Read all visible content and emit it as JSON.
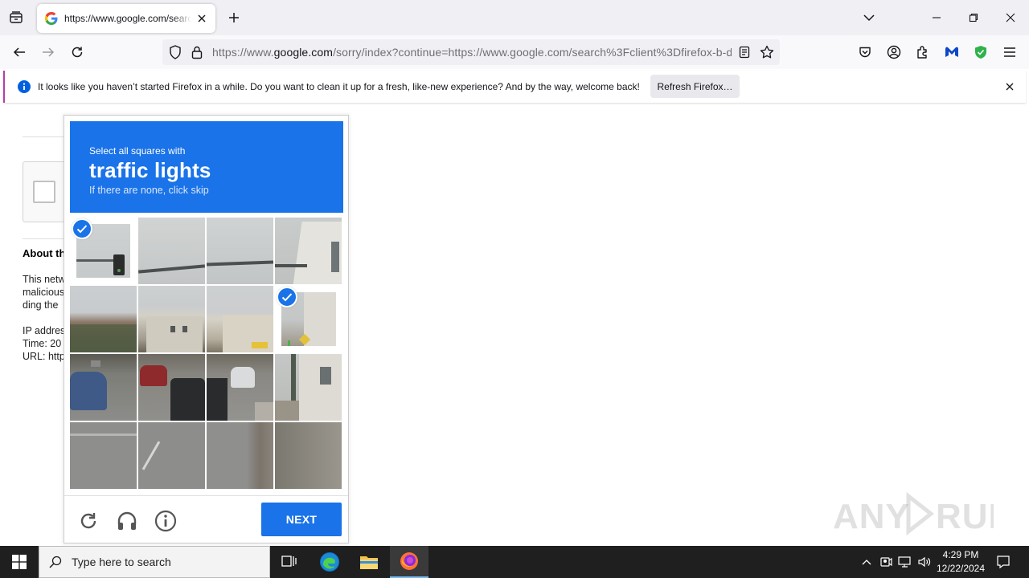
{
  "browser": {
    "tab_title": "https://www.google.com/search",
    "url_prefix": "https://www.",
    "url_host": "google.com",
    "url_rest": "/sorry/index?continue=https://www.google.com/search%3Fclient%3Dfirefox-b-d%"
  },
  "notification": {
    "message": "It looks like you haven’t started Firefox in a while. Do you want to clean it up for a fresh, like-new experience? And by the way, welcome back!",
    "button_label": "Refresh Firefox…"
  },
  "page": {
    "about_heading": "About th",
    "body_line1": "This netw",
    "body_line2": "malicious",
    "body_line3": "ding the",
    "ip_line": "IP addres",
    "time_line": "Time: 20",
    "url_line": "URL: http"
  },
  "captcha": {
    "instruction_small": "Select all squares with",
    "target": "traffic lights",
    "instruction_skip": "If there are none, click skip",
    "next_label": "NEXT",
    "selected_tiles": [
      0,
      7
    ]
  },
  "taskbar": {
    "search_placeholder": "Type here to search",
    "time": "4:29 PM",
    "date": "12/22/2024"
  },
  "watermark": "ANY RUN",
  "colors": {
    "accent": "#1a73e8",
    "tabstrip": "#f0f0f4",
    "taskbar": "#1f1f1f"
  },
  "icons": [
    "tab-list-icon",
    "google-favicon",
    "close-icon",
    "plus-icon",
    "chevron-down-icon",
    "minimize-icon",
    "restore-icon",
    "back-icon",
    "forward-icon",
    "reload-icon",
    "shield-icon",
    "lock-icon",
    "reader-view-icon",
    "star-icon",
    "pocket-icon",
    "account-icon",
    "extensions-icon",
    "malwarebytes-icon",
    "adblock-shield-icon",
    "menu-icon",
    "info-icon",
    "checkmark-icon",
    "headphones-icon",
    "windows-icon",
    "magnifier-icon",
    "task-view-icon",
    "edge-icon",
    "file-explorer-icon",
    "firefox-icon",
    "tray-chevron-icon",
    "network-icon",
    "volume-icon",
    "notification-icon"
  ]
}
